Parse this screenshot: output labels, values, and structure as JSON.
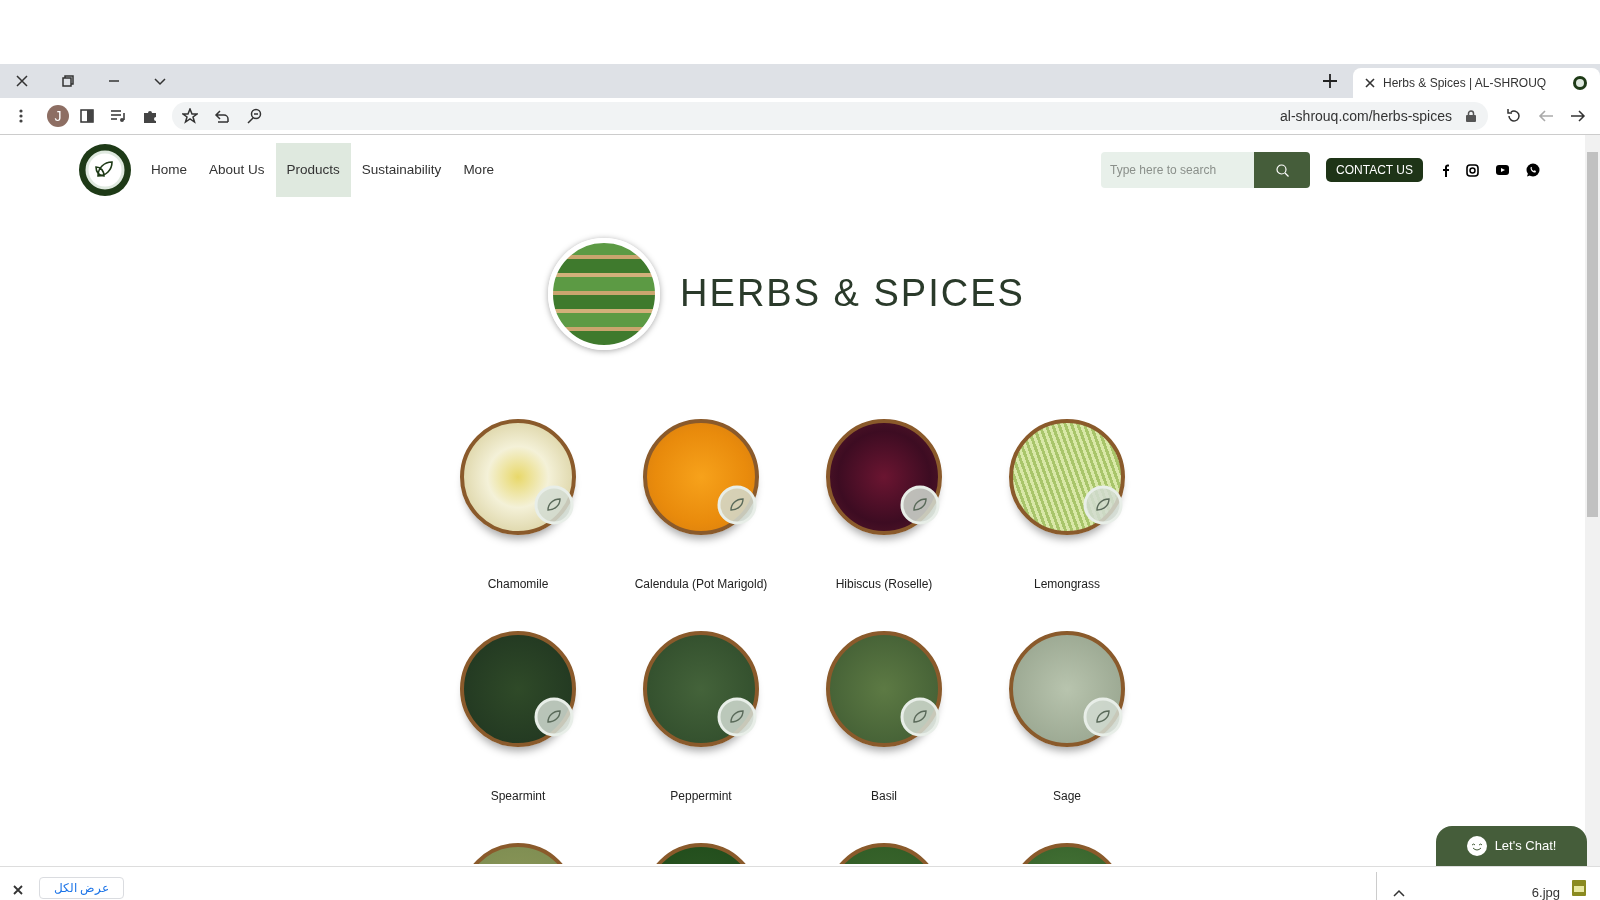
{
  "browser": {
    "tab_title": "Herbs & Spices | AL-SHROUQ",
    "url": "al-shrouq.com/herbs-spices",
    "avatar_letter": "J"
  },
  "nav": [
    {
      "label": "Home",
      "selected": false
    },
    {
      "label": "About Us",
      "selected": false
    },
    {
      "label": "Products",
      "selected": true
    },
    {
      "label": "Sustainability",
      "selected": false
    },
    {
      "label": "More",
      "selected": false
    }
  ],
  "search": {
    "placeholder": "Type here to search"
  },
  "contact_button": "CONTACT US",
  "hero": {
    "title": "HERBS & SPICES"
  },
  "products": [
    {
      "name": "Chamomile",
      "cut_off": false
    },
    {
      "name": "Calendula (Pot Marigold)",
      "cut_off": false
    },
    {
      "name": "Hibiscus (Roselle)",
      "cut_off": false
    },
    {
      "name": "Lemongrass",
      "cut_off": false
    },
    {
      "name": "Spearmint",
      "cut_off": false
    },
    {
      "name": "Peppermint",
      "cut_off": false
    },
    {
      "name": "Basil",
      "cut_off": false
    },
    {
      "name": "Sage",
      "cut_off": false
    },
    {
      "cut_off": true
    },
    {
      "cut_off": true
    },
    {
      "cut_off": true
    },
    {
      "cut_off": true
    }
  ],
  "chat_button": "Let's Chat!",
  "download_bar": {
    "show_all": "عرض الكل",
    "file": "6.jpg"
  }
}
